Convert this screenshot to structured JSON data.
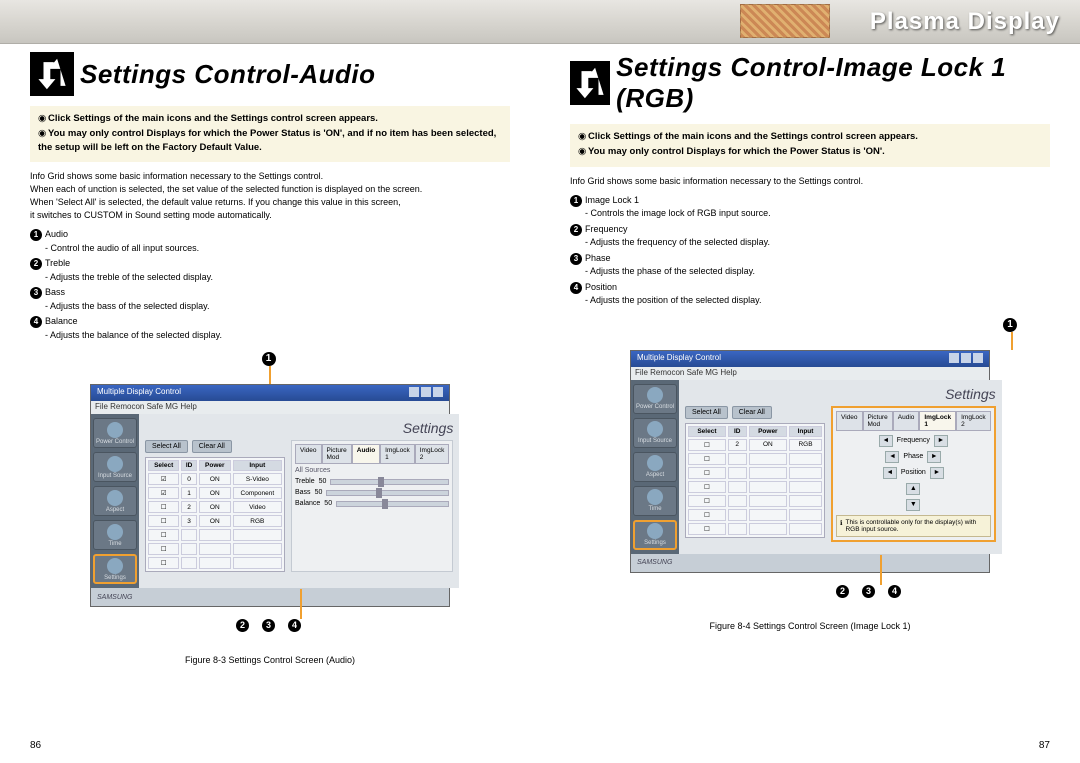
{
  "banner": {
    "title": "Plasma Display"
  },
  "left": {
    "heading": "Settings Control-Audio",
    "notes": [
      "Click Settings of the main icons and the Settings control screen appears.",
      "You may only control Displays for which the Power Status is 'ON', and if no item has been selected, the setup will be left on the Factory Default Value."
    ],
    "grid_note": "Info Grid shows some basic information necessary to the Settings control.\nWhen each of unction is selected, the set value of the selected function is displayed on the screen.\nWhen 'Select All' is selected, the default value returns. If you change this value in this screen,\nit switches to CUSTOM in Sound setting mode automatically.",
    "items": [
      {
        "n": "1",
        "t": "Audio",
        "d": "Control the audio of all input sources."
      },
      {
        "n": "2",
        "t": "Treble",
        "d": "Adjusts the treble of the selected display."
      },
      {
        "n": "3",
        "t": "Bass",
        "d": "Adjusts the bass of the selected display."
      },
      {
        "n": "4",
        "t": "Balance",
        "d": "Adjusts the balance of the selected display."
      }
    ],
    "screenshot": {
      "win_title": "Multiple Display Control",
      "menubar": "File  Remocon  Safe MG  Help",
      "settings": "Settings",
      "sidebar": [
        "Power Control",
        "Input Source",
        "Aspect",
        "Time",
        "Settings"
      ],
      "btns": [
        "Select All",
        "Clear All"
      ],
      "th": [
        "Select",
        "ID",
        "Power",
        "Input"
      ],
      "rows": [
        [
          "☑",
          "0",
          "ON",
          "S-Video"
        ],
        [
          "☑",
          "1",
          "ON",
          "Component"
        ],
        [
          "☐",
          "2",
          "ON",
          "Video"
        ],
        [
          "☐",
          "3",
          "ON",
          "RGB"
        ]
      ],
      "tabs": [
        "Video",
        "Picture Mod",
        "Audio",
        "ImgLock 1",
        "ImgLock 2"
      ],
      "source": "All Sources",
      "sliders": [
        "Treble",
        "Bass",
        "Balance"
      ],
      "sl_vals": [
        "50",
        "50",
        "50"
      ]
    },
    "caption": "Figure 8-3 Settings Control Screen (Audio)",
    "page": "86"
  },
  "right": {
    "heading": "Settings Control-Image Lock 1 (RGB)",
    "notes": [
      "Click Settings of the main icons and the Settings control screen appears.",
      "You may only control Displays for which the Power Status is 'ON'."
    ],
    "grid_note": "Info Grid shows some basic information necessary to the Settings control.",
    "items": [
      {
        "n": "1",
        "t": "Image Lock 1",
        "d": "Controls the image lock of RGB input source."
      },
      {
        "n": "2",
        "t": "Frequency",
        "d": "Adjusts the frequency of the selected display."
      },
      {
        "n": "3",
        "t": "Phase",
        "d": "Adjusts the phase of the selected display."
      },
      {
        "n": "4",
        "t": "Position",
        "d": "Adjusts the position of the selected display."
      }
    ],
    "screenshot": {
      "win_title": "Multiple Display Control",
      "menubar": "File  Remocon  Safe MG  Help",
      "settings": "Settings",
      "sidebar": [
        "Power Control",
        "Input Source",
        "Aspect",
        "Time",
        "Settings"
      ],
      "btns": [
        "Select All",
        "Clear All"
      ],
      "th": [
        "Select",
        "ID",
        "Power",
        "Input"
      ],
      "rows": [
        [
          "☐",
          "2",
          "ON",
          "RGB"
        ]
      ],
      "tabs": [
        "Video",
        "Picture Mod",
        "Audio",
        "ImgLock 1",
        "ImgLock 2"
      ],
      "controls": [
        "Frequency",
        "Phase",
        "Position"
      ],
      "msg": "This is controllable only for the display(s) with RGB input source."
    },
    "caption": "Figure 8-4 Settings Control Screen (Image Lock 1)",
    "page": "87"
  }
}
